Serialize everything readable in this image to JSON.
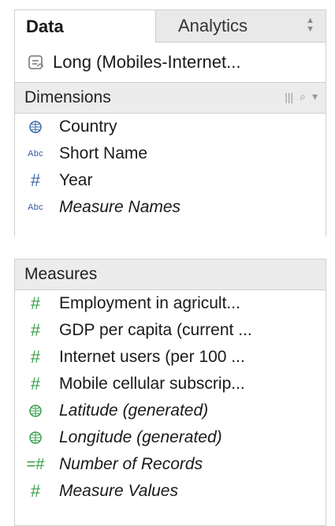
{
  "tabs": {
    "data": "Data",
    "analytics": "Analytics"
  },
  "source": {
    "label": "Long  (Mobiles-Internet..."
  },
  "dimensions": {
    "header": "Dimensions",
    "items": [
      {
        "label": "Country",
        "icon": "globe-icon"
      },
      {
        "label": "Short Name",
        "icon": "abc-icon"
      },
      {
        "label": "Year",
        "icon": "hash-icon"
      },
      {
        "label": "Measure Names",
        "icon": "abc-icon"
      }
    ]
  },
  "measures": {
    "header": "Measures",
    "items": [
      {
        "label": "Employment in agricult...",
        "icon": "hash-icon"
      },
      {
        "label": "GDP per capita (current ...",
        "icon": "hash-icon"
      },
      {
        "label": "Internet users (per 100 ...",
        "icon": "hash-icon"
      },
      {
        "label": "Mobile cellular subscrip...",
        "icon": "hash-icon"
      },
      {
        "label": "Latitude (generated)",
        "icon": "globe-icon"
      },
      {
        "label": "Longitude (generated)",
        "icon": "globe-icon"
      },
      {
        "label": "Number of Records",
        "icon": "equals-hash-icon"
      },
      {
        "label": "Measure Values",
        "icon": "hash-icon"
      }
    ]
  },
  "colors": {
    "dimension": "#3b6aa8",
    "measure": "#3aa04a",
    "header_bg": "#ececec"
  }
}
